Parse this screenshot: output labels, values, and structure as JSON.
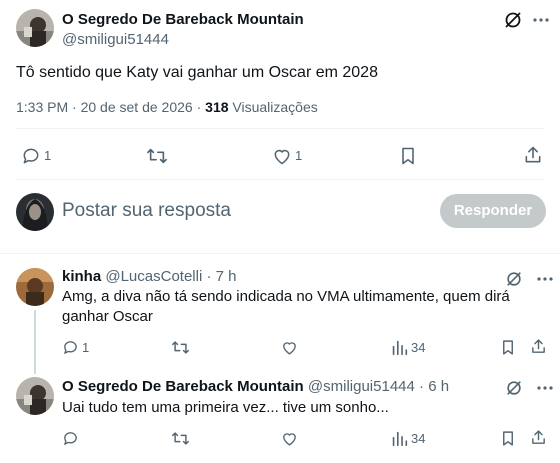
{
  "main_tweet": {
    "author_name": "O Segredo De Bareback Mountain",
    "author_handle": "@smiligui51444",
    "text": "Tô sentido que Katy vai ganhar um Oscar em 2028",
    "time": "1:33 PM",
    "date": "20 de set de 2026",
    "views_count": "318",
    "views_label": "Visualizações",
    "replies": "1",
    "retweets": "",
    "likes": "1"
  },
  "composer": {
    "placeholder": "Postar sua resposta",
    "button_label": "Responder"
  },
  "replies": [
    {
      "author_name": "kinha",
      "author_handle": "@LucasCotelli",
      "time": "7 h",
      "text": "Amg, a diva não tá sendo indicada no VMA ultimamente, quem dirá ganhar Oscar",
      "replies": "1",
      "retweets": "",
      "likes": "",
      "views": "34"
    },
    {
      "author_name": "O Segredo De Bareback Mountain",
      "author_handle": "@smiligui51444",
      "time": "6 h",
      "text": "Uai tudo tem uma primeira vez... tive um sonho...",
      "replies": "",
      "retweets": "",
      "likes": "",
      "views": "34"
    }
  ],
  "colors": {
    "text_primary": "#0f1419",
    "text_secondary": "#536471",
    "divider": "#eff3f4",
    "button_disabled": "#c4c9cc"
  },
  "icons": {
    "grok": "grok-icon",
    "reply": "reply-icon",
    "retweet": "retweet-icon",
    "like": "like-icon",
    "bookmark": "bookmark-icon",
    "share": "share-icon",
    "views": "views-icon"
  }
}
